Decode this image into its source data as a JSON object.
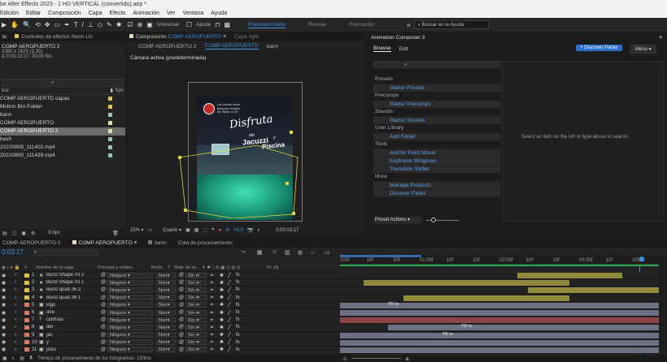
{
  "window_title": "be After Effects 2023 - 1 HD VERTICAL (convertido).aep *",
  "menu": [
    "Edición",
    "Editar",
    "Composición",
    "Capa",
    "Efecto",
    "Animación",
    "Ver",
    "Ventana",
    "Ayuda"
  ],
  "toolbar": {
    "universal_label": "Universal",
    "ajuste_label": "Ajuste",
    "workspaces": [
      "Predeterminado",
      "Revisar",
      "Formación"
    ],
    "active_workspace": "Predeterminado",
    "search_placeholder": "Buscar en la Ayuda"
  },
  "project_panel": {
    "tab1": "to",
    "tab2": "Controles de efectos Neon Lin",
    "comp_name": "COMP AEROPUERTO 2",
    "comp_info1": "1080 x 1920 (1,00)",
    "comp_info2": "Δ 0:03:13:27, 30,00 fps",
    "col_name": "bre",
    "col_type": "Tipo",
    "items": [
      {
        "name": "COMP AEROPUERTO capas",
        "color": "#d8c24a"
      },
      {
        "name": "Motion Bro Folder",
        "color": "#d8c24a"
      },
      {
        "name": "bann",
        "color": "#9dbfc0"
      },
      {
        "name": "COMP AEROPUERTO",
        "color": "#e4d9b5"
      },
      {
        "name": "COMP AEROPUERTO 2",
        "color": "#e4d9b5"
      },
      {
        "name": "bash",
        "color": "#9dbfc0"
      },
      {
        "name": "20220809_111402.mp4",
        "color": "#9dbfc0"
      },
      {
        "name": "20220809_111439.mp4",
        "color": "#9dbfc0"
      }
    ],
    "selected_index": 4,
    "bpc": "8 bpc"
  },
  "comp_panel": {
    "tab_label": "Composición",
    "tab_name": "COMP AEROPUERTO",
    "tab_other": "Capa right",
    "breadcrumbs": [
      "COMP AEROPUERTO 2",
      "COMP AEROPUERTO",
      "bann"
    ],
    "camera_label": "Cámara activa (predeterminada)",
    "poster": {
      "small_text": "Los Santos Leeds\nBenjamin Hoskins\nMo Sitaler 14,15",
      "line1": "Disfruta",
      "line2": "del",
      "line3": "Jacuzzi",
      "line4": "y",
      "line5": "Piscina"
    },
    "zoom": "25%",
    "resolution": "Cuarto",
    "exposure": "+0,0",
    "timecode": "0:00:03:17"
  },
  "animation_composer": {
    "title": "Animation Composer 3",
    "tab_browse": "Browse",
    "tab_edit": "Edit",
    "discover_button": "+ Discover Packs",
    "menu_button": "Menu",
    "sections": [
      {
        "title": "Presets",
        "items": [
          "Starter Presets"
        ]
      },
      {
        "title": "Precomps",
        "items": [
          "Starter Precomps"
        ]
      },
      {
        "title": "Sounds",
        "items": [
          "Starter Sounds"
        ]
      },
      {
        "title": "User Library",
        "items": [
          "Add Folder"
        ]
      },
      {
        "title": "Tools",
        "items": [
          "Anchor Point Mover",
          "Keyframe Wingman",
          "Transition Shifter"
        ]
      },
      {
        "title": "More",
        "items": [
          "Manage Products",
          "Discover Packs"
        ]
      }
    ],
    "empty_text": "Select an item on the left or type above to search.",
    "preset_actions": "Preset Actions"
  },
  "timeline": {
    "tabs": [
      "COMP AEROPUERTO 2",
      "COMP AEROPUERTO",
      "bann",
      "Cola de procesamiento"
    ],
    "active_tab": "COMP AEROPUERTO",
    "current_time": "0:03:17",
    "columns": {
      "name": "Nombre de la capa",
      "parent": "Principal y enlace",
      "mode": "Modo",
      "t": "T",
      "matte": "Mate de se...",
      "fx": "Ft. clx"
    },
    "ruler": [
      "100f",
      "10f",
      "20f",
      "01:00f",
      "10f",
      "20f",
      "02:00f",
      "10f",
      "20f",
      "03:00f",
      "10f",
      "20f"
    ],
    "layers": [
      {
        "num": "1",
        "name": "Burst Shape 03 2",
        "kind": "star",
        "color": "#d8c24a",
        "parent": "Ninguno",
        "mode": "Norr",
        "matte": "Sin r",
        "bar": {
          "start": 0.555,
          "end": 0.885,
          "color": "#8f8a3c"
        }
      },
      {
        "num": "2",
        "name": "Burst Shape 03 1",
        "kind": "star",
        "color": "#d8c24a",
        "parent": "Ninguno",
        "mode": "Norr",
        "matte": "Sin r",
        "bar": {
          "start": 0.075,
          "end": 0.72,
          "color": "#8f8a3c"
        }
      },
      {
        "num": "3",
        "name": "Burst quad 36 2",
        "kind": "star",
        "color": "#d8c24a",
        "parent": "Ninguno",
        "mode": "Norr",
        "matte": "Sin r",
        "bar": {
          "start": 0.59,
          "end": 1.0,
          "color": "#8f8a3c"
        }
      },
      {
        "num": "4",
        "name": "Burst quad 36 1",
        "kind": "star",
        "color": "#d8c24a",
        "parent": "Ninguno",
        "mode": "Norr",
        "matte": "Sin r",
        "bar": {
          "start": 0.2,
          "end": 0.72,
          "color": "#8f8a3c"
        }
      },
      {
        "num": "5",
        "name": "logo",
        "kind": "comp",
        "color": "#d87a6a",
        "parent": "Ninguno",
        "mode": "Norr",
        "matte": "Sin r",
        "bar": {
          "start": 0.0,
          "end": 1.0,
          "color": "#6e7183"
        },
        "label": "TR In",
        "label_pos": 0.15
      },
      {
        "num": "6",
        "name": "dire",
        "kind": "comp",
        "color": "#d87a6a",
        "parent": "Ninguno",
        "mode": "Norr",
        "matte": "Sin r",
        "bar": {
          "start": 0.0,
          "end": 1.0,
          "color": "#6e7183"
        }
      },
      {
        "num": "7",
        "name": "Disfruta",
        "kind": "text",
        "color": "#d87a6a",
        "parent": "Ninguno",
        "mode": "Norr",
        "matte": "Sin r",
        "bar": {
          "start": 0.0,
          "end": 1.0,
          "color": "#8a4545"
        }
      },
      {
        "num": "8",
        "name": "del",
        "kind": "comp",
        "color": "#d87a6a",
        "parent": "Ninguno",
        "mode": "Norr",
        "matte": "Sin r",
        "bar": {
          "start": 0.15,
          "end": 1.0,
          "color": "#6e7183"
        },
        "label": "TR In",
        "label_pos": 0.38
      },
      {
        "num": "9",
        "name": "jac",
        "kind": "comp",
        "color": "#d87a6a",
        "parent": "Ninguno",
        "mode": "Norr",
        "matte": "Sin r",
        "bar": {
          "start": 0.0,
          "end": 1.0,
          "color": "#6e7183"
        },
        "label": "TR In",
        "label_pos": 0.32
      },
      {
        "num": "10",
        "name": "y",
        "kind": "comp",
        "color": "#d87a6a",
        "parent": "Ninguno",
        "mode": "Norr",
        "matte": "Sin r",
        "bar": {
          "start": 0.0,
          "end": 1.0,
          "color": "#6e7183"
        }
      },
      {
        "num": "11",
        "name": "pisci",
        "kind": "comp",
        "color": "#d87a6a",
        "parent": "Ninguno",
        "mode": "Norr",
        "matte": "Sin r",
        "bar": {
          "start": 0.0,
          "end": 1.0,
          "color": "#6e7183"
        }
      }
    ],
    "status": "Tiempo de procesamiento de los fotogramas: 150ms"
  },
  "colors": {
    "accent": "#3b8fe0",
    "button_blue": "#2a6fce"
  }
}
